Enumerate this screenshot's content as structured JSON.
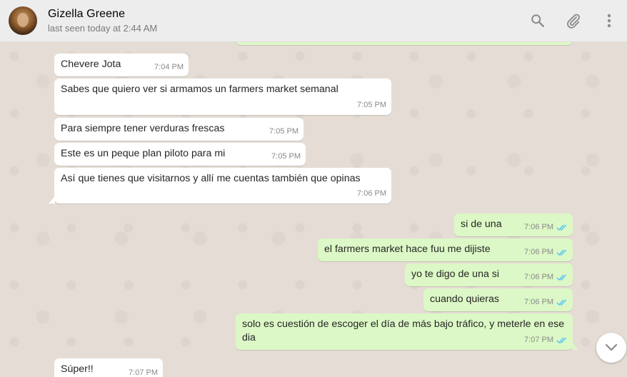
{
  "header": {
    "contact_name": "Gizella Greene",
    "last_seen": "last seen today at 2:44 AM",
    "icons": [
      "search-icon",
      "attach-icon",
      "menu-icon"
    ]
  },
  "messages": [
    {
      "direction": "in",
      "text": "Chevere Jota",
      "time": "7:04 PM"
    },
    {
      "direction": "in",
      "text": "Sabes que quiero ver si armamos un farmers market semanal",
      "time": "7:05 PM"
    },
    {
      "direction": "in",
      "text": "Para siempre tener verduras frescas",
      "time": "7:05 PM"
    },
    {
      "direction": "in",
      "text": "Este es un peque plan piloto para mi",
      "time": "7:05 PM"
    },
    {
      "direction": "in",
      "text": "Así que tienes que visitarnos y allí me cuentas también que opinas",
      "time": "7:06 PM"
    },
    {
      "direction": "out",
      "text": "si de una",
      "time": "7:06 PM",
      "status": "read"
    },
    {
      "direction": "out",
      "text": "el farmers market hace fuu me dijiste",
      "time": "7:06 PM",
      "status": "read"
    },
    {
      "direction": "out",
      "text": "yo te digo de una si",
      "time": "7:06 PM",
      "status": "read"
    },
    {
      "direction": "out",
      "text": "cuando quieras",
      "time": "7:06 PM",
      "status": "read"
    },
    {
      "direction": "out",
      "text": "solo es cuestión de escoger el día de más bajo tráfico, y meterle en ese dia",
      "time": "7:07 PM",
      "status": "read"
    },
    {
      "direction": "in",
      "text": "Súper!!",
      "time": "7:07 PM"
    }
  ],
  "colors": {
    "incoming_bubble": "#ffffff",
    "outgoing_bubble": "#dcf8c6",
    "read_tick": "#4fc3f7",
    "chat_background": "#e5ddd5"
  }
}
